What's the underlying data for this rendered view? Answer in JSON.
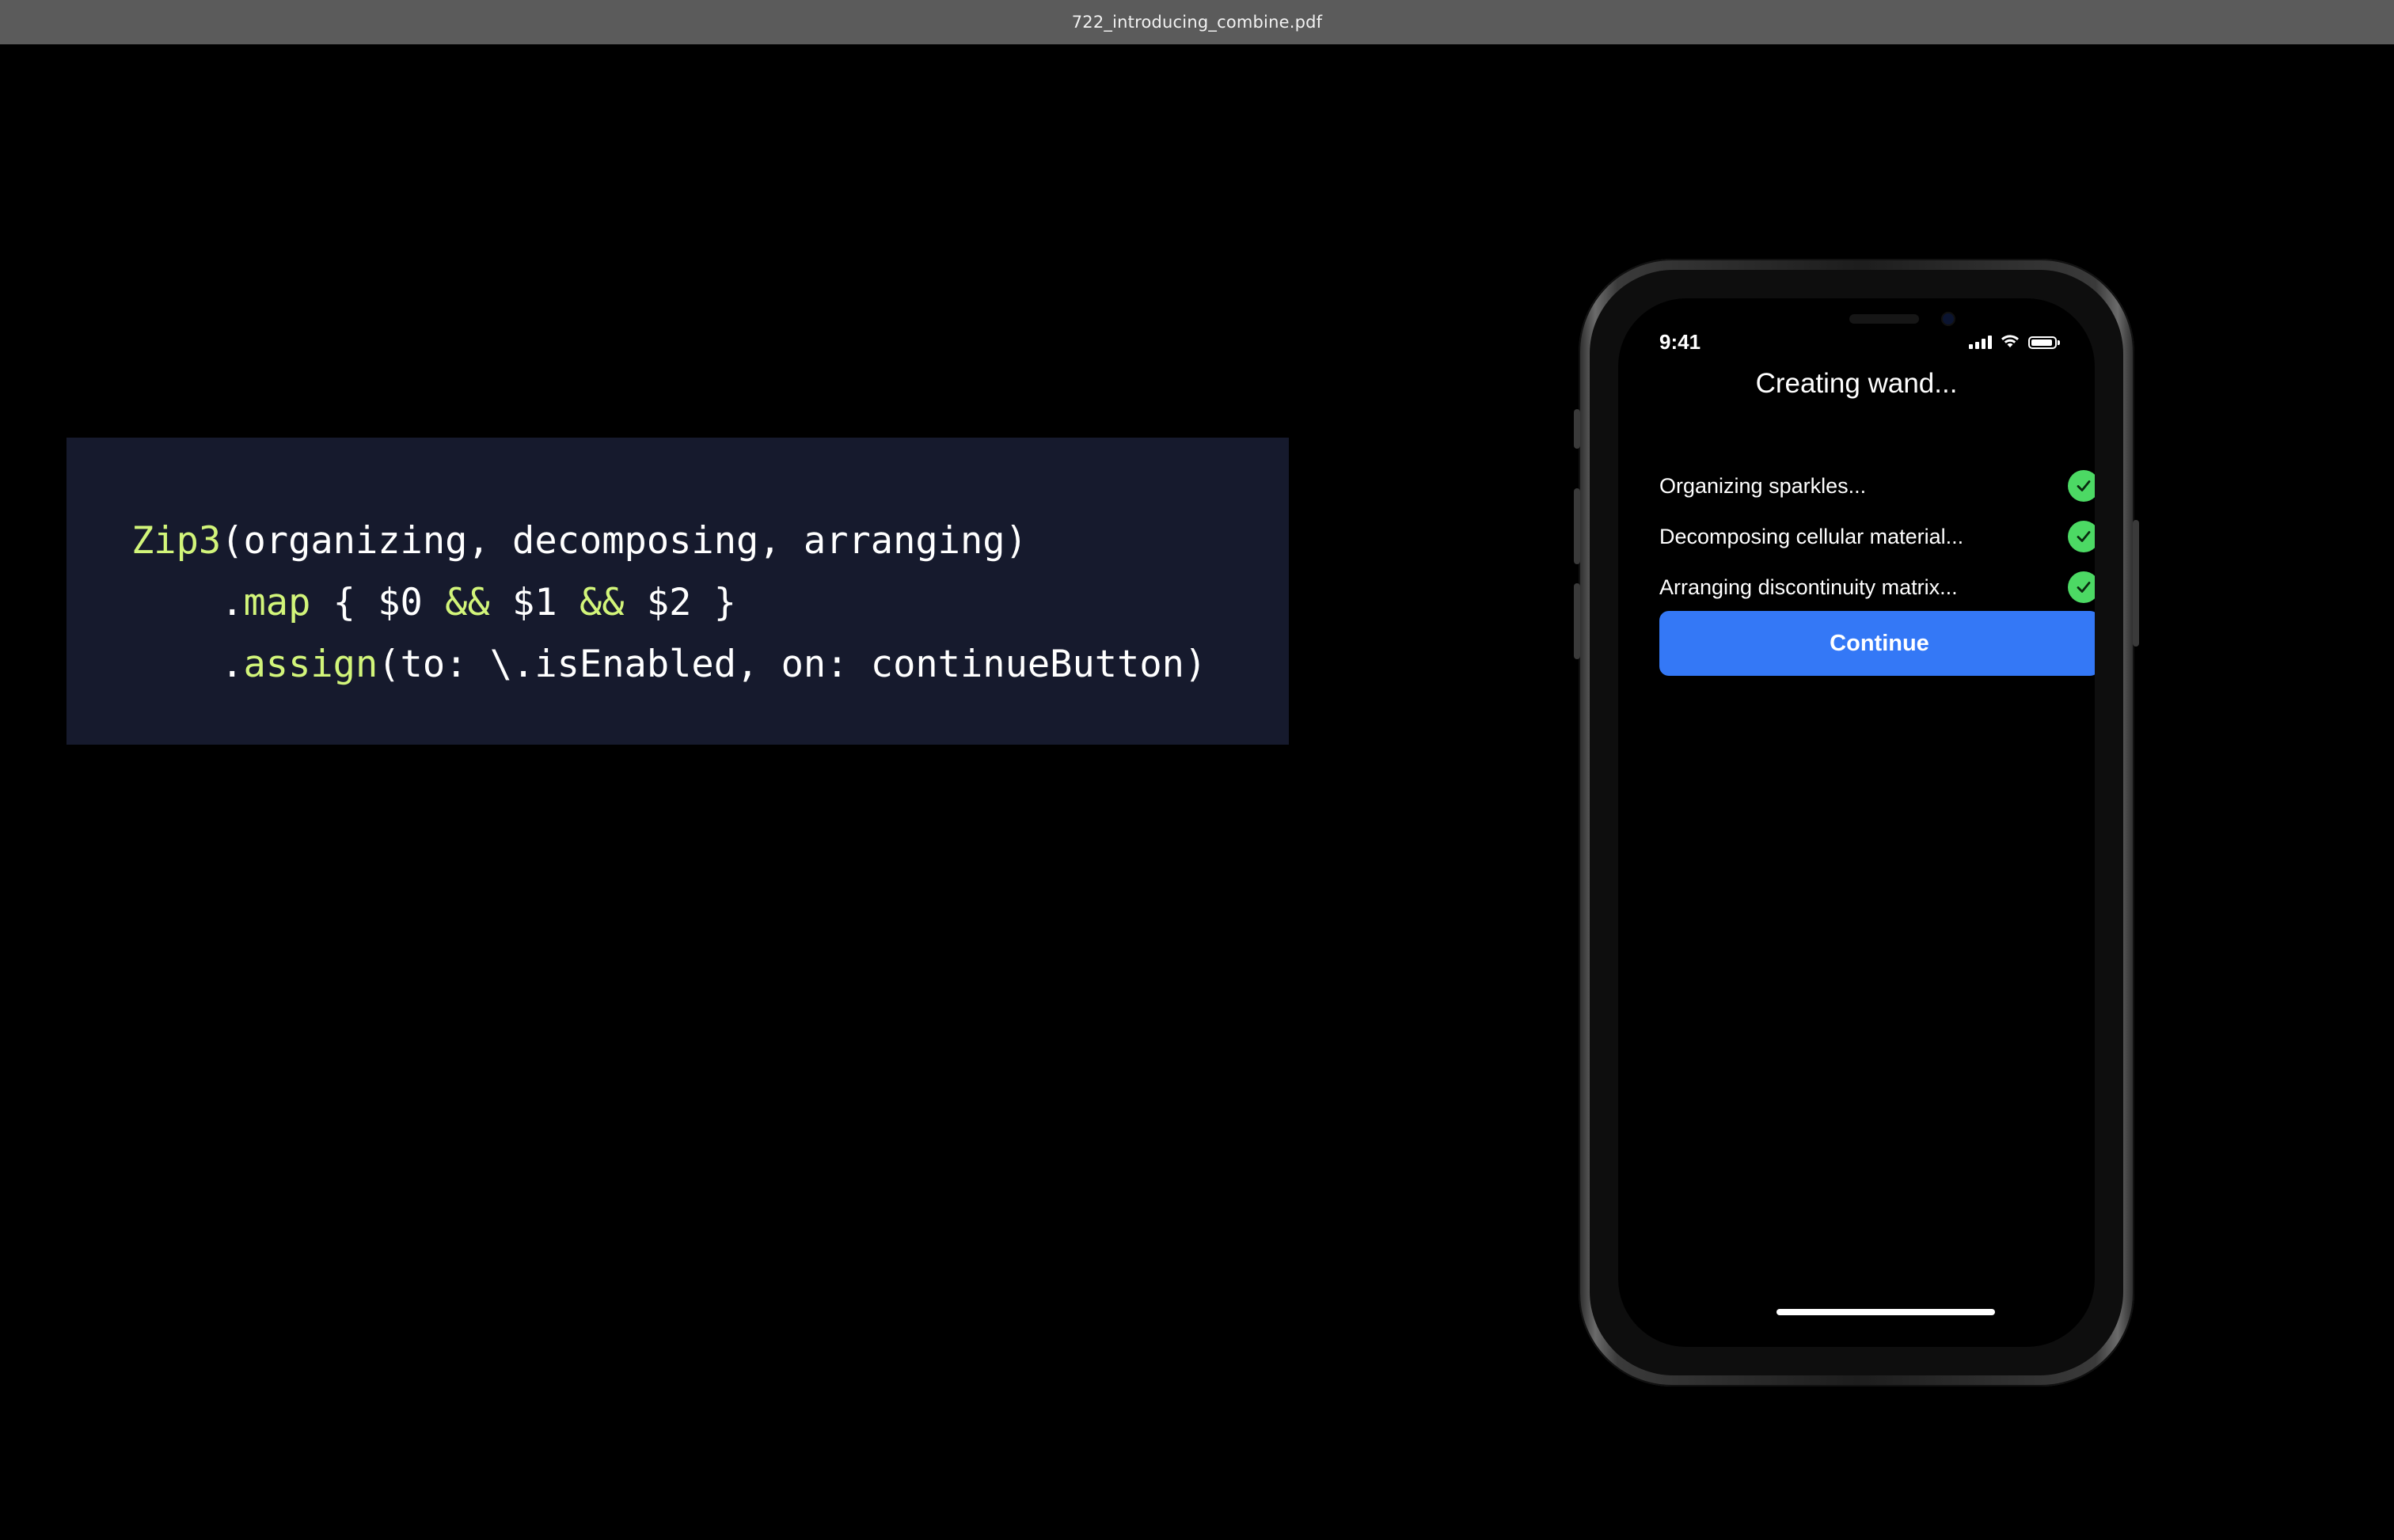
{
  "window": {
    "title": "722_introducing_combine.pdf"
  },
  "code": {
    "line1": {
      "fn": "Zip3",
      "rest": "(organizing, decomposing, arranging)"
    },
    "line2": {
      "indent": "    .",
      "fn": "map",
      "a": " { $0 ",
      "op1": "&&",
      "b": " $1 ",
      "op2": "&&",
      "c": " $2 }"
    },
    "line3": {
      "indent": "    .",
      "fn": "assign",
      "rest": "(to: \\.isEnabled, on: continueButton)"
    }
  },
  "phone": {
    "status_time": "9:41",
    "screen_title": "Creating wand...",
    "tasks": [
      {
        "label": "Organizing sparkles...",
        "done": true
      },
      {
        "label": "Decomposing cellular material...",
        "done": true
      },
      {
        "label": "Arranging discontinuity matrix...",
        "done": true
      }
    ],
    "continue_label": "Continue",
    "colors": {
      "accent": "#3478f6",
      "check": "#4cd964",
      "code_keyword": "#d2f57a",
      "code_background": "#161a2d"
    }
  }
}
